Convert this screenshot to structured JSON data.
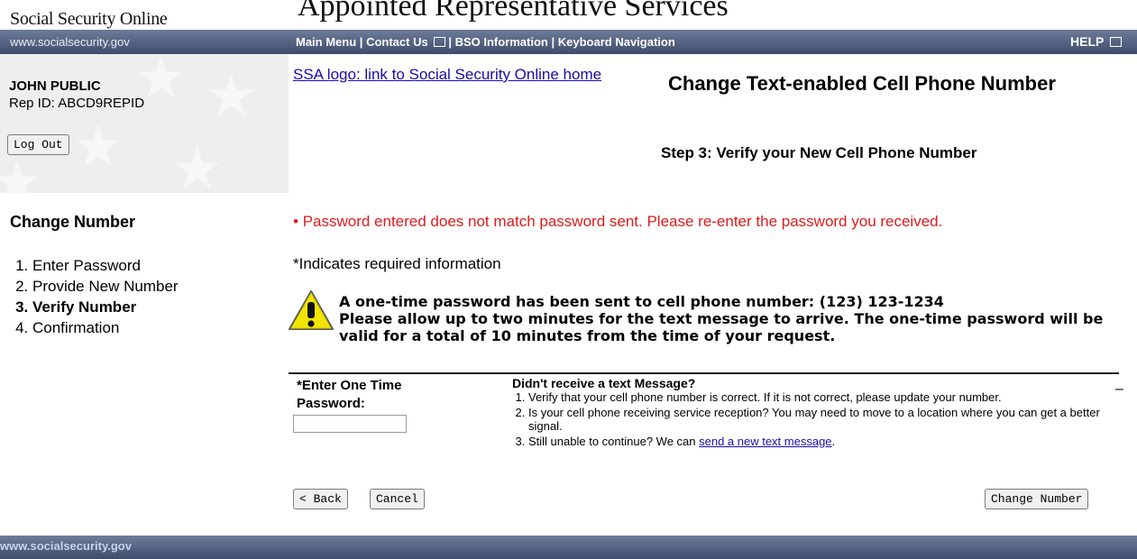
{
  "header": {
    "site_name": "Social Security Online",
    "app_title": "Appointed Representative Services",
    "site_url": "www.socialsecurity.gov",
    "nav": {
      "main_menu": "Main Menu",
      "contact_us": "Contact Us",
      "bso_information": "BSO Information",
      "keyboard_navigation": "Keyboard Navigation",
      "separator": "|",
      "help": "HELP"
    }
  },
  "user": {
    "name": "JOHN PUBLIC",
    "rep_id": "Rep ID: ABCD9REPID",
    "logout_label": "Log Out"
  },
  "content": {
    "logo_link_text": "SSA logo: link to Social Security Online home",
    "page_title": "Change Text-enabled Cell Phone Number",
    "step_title": "Step 3: Verify your New Cell Phone Number",
    "error_message": "Password entered does not match password sent. Please re-enter the password you received.",
    "required_note": "*Indicates required information",
    "warning_line1": "A one-time password has been sent to cell phone number: (123) 123-1234",
    "warning_line2": "Please allow up to two minutes for the text message to arrive. The one-time password will be valid for a total of 10 minutes from the time of your request."
  },
  "sidebar": {
    "heading": "Change Number",
    "steps": [
      {
        "label": "Enter Password"
      },
      {
        "label": "Provide New Number"
      },
      {
        "label": "Verify Number"
      },
      {
        "label": "Confirmation"
      }
    ]
  },
  "form": {
    "otp_label_line1": "*Enter One Time",
    "otp_label_line2": "Password:",
    "otp_value": "",
    "help_heading": "Didn't receive a text Message?",
    "help_items": [
      "Verify that your cell phone number is correct. If it is not correct, please update your number.",
      "Is your cell phone receiving service reception? You may need to move to a location where you can get a better signal.",
      "Still unable to continue? We can "
    ],
    "help_link": "send a new text message",
    "help_suffix": ".",
    "collapse": "–",
    "back_label": "< Back",
    "cancel_label": "Cancel",
    "change_label": "Change Number"
  },
  "footer": {
    "url": "www.socialsecurity.gov"
  },
  "colors": {
    "nav_bar": "#4f5c7b",
    "error": "#e01b1b",
    "link": "#1a0dab",
    "warning_icon": "#f2e600"
  }
}
